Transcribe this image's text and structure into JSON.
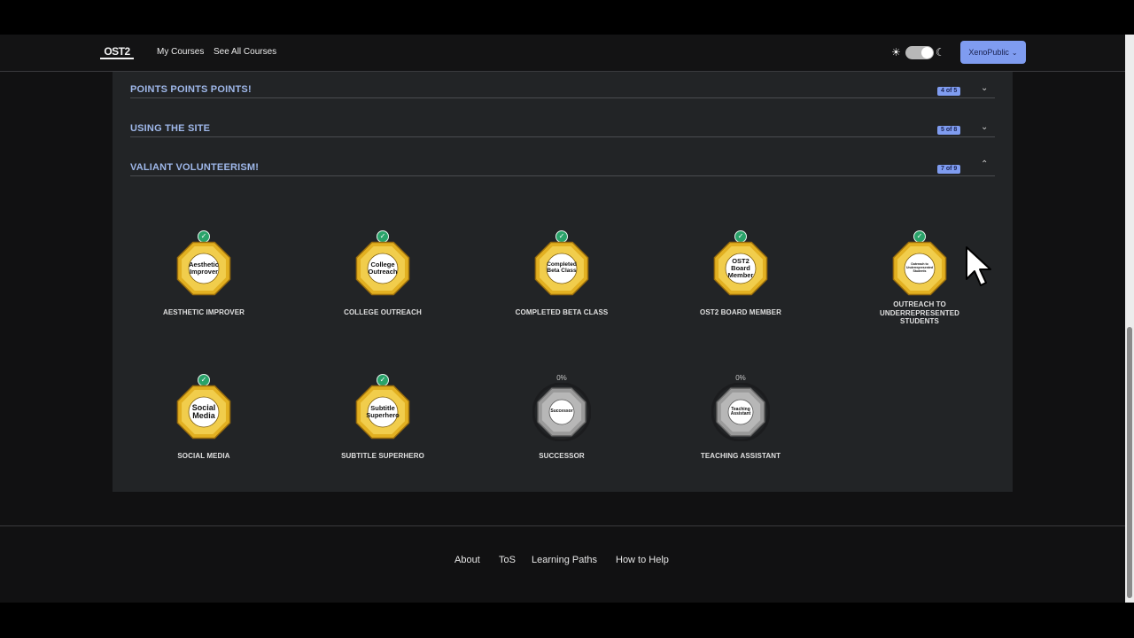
{
  "nav": {
    "logo_text": "OST2",
    "links": [
      "My Courses",
      "See All Courses"
    ],
    "theme": {
      "sun_icon": "☀",
      "moon_icon": "☾"
    },
    "user_button": "XenoPublic",
    "user_chevron": "⌄"
  },
  "sections": [
    {
      "title": "POINTS POINTS POINTS!",
      "progress": "4 of 5",
      "expanded": false
    },
    {
      "title": "USING THE SITE",
      "progress": "5 of 8",
      "expanded": false
    },
    {
      "title": "VALIANT VOLUNTEERISM!",
      "progress": "7 of 9",
      "expanded": true
    }
  ],
  "chevrons": {
    "down": "⌄",
    "up": "⌃"
  },
  "badges": [
    {
      "medal_text": "Aesthetic Improver",
      "label": "AESTHETIC IMPROVER",
      "earned": true,
      "check": "✓"
    },
    {
      "medal_text": "College Outreach",
      "label": "COLLEGE OUTREACH",
      "earned": true,
      "check": "✓"
    },
    {
      "medal_text": "Completed Beta Class",
      "label": "COMPLETED BETA CLASS",
      "earned": true,
      "check": "✓"
    },
    {
      "medal_text": "OST2 Board Member",
      "label": "OST2 BOARD MEMBER",
      "earned": true,
      "check": "✓"
    },
    {
      "medal_text": "Outreach to Underrepresented Students",
      "label": "OUTREACH TO UNDERREPRESENTED STUDENTS",
      "earned": true,
      "check": "✓"
    },
    {
      "medal_text": "Social Media",
      "label": "SOCIAL MEDIA",
      "earned": true,
      "check": "✓"
    },
    {
      "medal_text": "Subtitle Superhero",
      "label": "SUBTITLE SUPERHERO",
      "earned": true,
      "check": "✓"
    },
    {
      "medal_text": "Successor",
      "label": "SUCCESSOR",
      "earned": false,
      "progress": "0%"
    },
    {
      "medal_text": "Teaching Assistant",
      "label": "TEACHING ASSISTANT",
      "earned": false,
      "progress": "0%"
    }
  ],
  "footer": {
    "links": [
      "About",
      "ToS",
      "Learning Paths",
      "How to Help"
    ]
  },
  "colors": {
    "accent": "#7f9cf0",
    "section_title": "#9fb8ea",
    "earned_gold": "#e2b021",
    "check_green": "#2aa36a",
    "locked_gray": "#9a9a9a"
  }
}
